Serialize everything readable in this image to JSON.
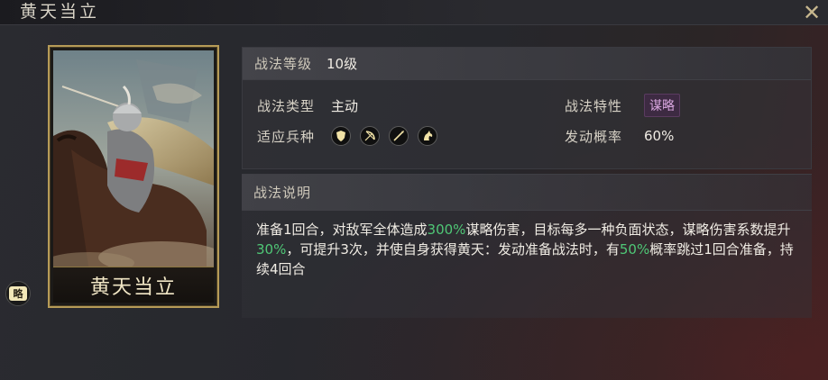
{
  "header": {
    "title": "黄天当立",
    "close_icon": "close-icon"
  },
  "card": {
    "name": "黄天当立",
    "badge_text": "略"
  },
  "info": {
    "level_label": "战法等级",
    "level_value": "10级",
    "type_label": "战法类型",
    "type_value": "主动",
    "trait_label": "战法特性",
    "trait_value": "谋略",
    "troops_label": "适应兵种",
    "troops": [
      "shield-icon",
      "bow-icon",
      "spear-icon",
      "horse-icon"
    ],
    "rate_label": "发动概率",
    "rate_value": "60%"
  },
  "description": {
    "label": "战法说明",
    "segments": [
      {
        "text": "准备1回合，对敌军全体造成",
        "hl": false
      },
      {
        "text": "300%",
        "hl": true
      },
      {
        "text": "谋略伤害，目标每多一种负面状态，谋略伤害系数提升",
        "hl": false
      },
      {
        "text": "30%",
        "hl": true
      },
      {
        "text": "，可提升3次，并使自身获得黄天：发动准备战法时，有",
        "hl": false
      },
      {
        "text": "50%",
        "hl": true
      },
      {
        "text": "概率跳过1回合准备，持续4回合",
        "hl": false
      }
    ]
  },
  "colors": {
    "highlight": "#4fc776",
    "card_border": "#b69b57",
    "strategy_tag": "#d9a6df"
  }
}
